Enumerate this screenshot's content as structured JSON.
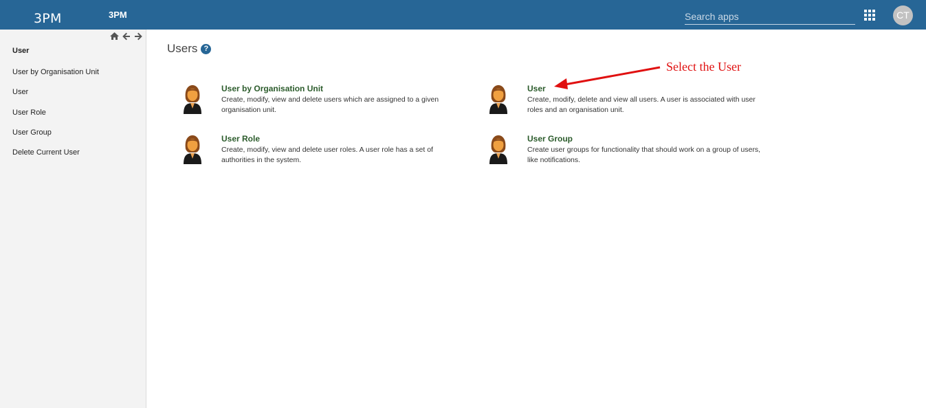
{
  "header": {
    "logo": "3PM",
    "app_title": "3PM",
    "search_placeholder": "Search apps",
    "apps_icon": "apps-grid-icon",
    "avatar_initials": "CT",
    "color": "#276696"
  },
  "sidebar": {
    "nav_icons": [
      "home-icon",
      "arrow-left-icon",
      "arrow-right-icon"
    ],
    "title": "User",
    "items": [
      {
        "label": "User by Organisation Unit"
      },
      {
        "label": "User"
      },
      {
        "label": "User Role"
      },
      {
        "label": "User Group"
      },
      {
        "label": "Delete Current User"
      }
    ]
  },
  "main": {
    "title": "Users",
    "help_icon": "question-circle-icon",
    "cards": [
      {
        "title": "User by Organisation Unit",
        "description": "Create, modify, view and delete users which are assigned to a given organisation unit."
      },
      {
        "title": "User",
        "description": "Create, modify, delete and view all users. A user is associated with user roles and an organisation unit."
      },
      {
        "title": "User Role",
        "description": "Create, modify, view and delete user roles. A user role has a set of authorities in the system."
      },
      {
        "title": "User Group",
        "description": "Create user groups for functionality that should work on a group of users, like notifications."
      }
    ]
  },
  "annotation": {
    "text": "Select the User",
    "color": "#e01010"
  }
}
